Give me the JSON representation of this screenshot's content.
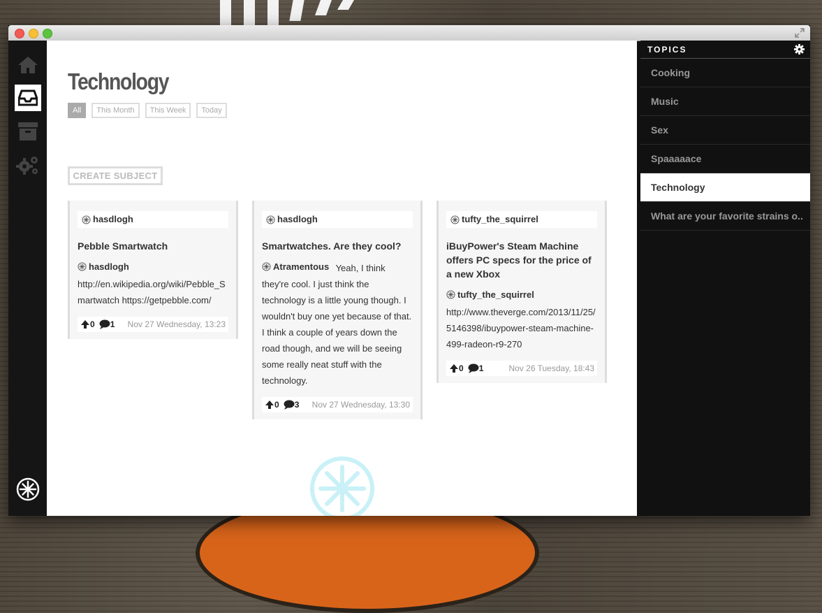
{
  "page": {
    "title": "Technology",
    "filters": [
      {
        "label": "All",
        "active": true
      },
      {
        "label": "This Month",
        "active": false
      },
      {
        "label": "This Week",
        "active": false
      },
      {
        "label": "Today",
        "active": false
      }
    ],
    "create_button": "CREATE SUBJECT"
  },
  "left_nav": {
    "items": [
      {
        "icon": "home-icon"
      },
      {
        "icon": "inbox-icon",
        "active": true
      },
      {
        "icon": "archive-icon"
      },
      {
        "icon": "gears-icon"
      }
    ],
    "footer_icon": "app-logo-icon"
  },
  "cards": [
    {
      "author": "hasdlogh",
      "subject": "Pebble Smartwatch",
      "post_author": "hasdlogh",
      "body": "http://en.wikipedia.org/wiki/Pebble_Smartwatch https://getpebble.com/",
      "upvotes": "0",
      "comments": "1",
      "date": "Nov 27 Wednesday, 13:23"
    },
    {
      "author": "hasdlogh",
      "subject": "Smartwatches. Are they cool?",
      "post_author": "Atramentous",
      "body": "Yeah, I think they're cool. I just think the technology is a little young though. I wouldn't buy one yet because of that. I think a couple of years down the road though, and we will be seeing some really neat stuff with the technology.",
      "upvotes": "0",
      "comments": "3",
      "date": "Nov 27 Wednesday, 13:30"
    },
    {
      "author": "tufty_the_squirrel",
      "subject": "iBuyPower's Steam Machine offers PC specs for the price of a new Xbox",
      "post_author": "tufty_the_squirrel",
      "body": "http://www.theverge.com/2013/11/25/5146398/ibuypower-steam-machine-499-radeon-r9-270",
      "upvotes": "0",
      "comments": "1",
      "date": "Nov 26 Tuesday, 18:43"
    }
  ],
  "topics": {
    "header": "TOPICS",
    "items": [
      {
        "label": "Cooking",
        "active": false
      },
      {
        "label": "Music",
        "active": false
      },
      {
        "label": "Sex",
        "active": false
      },
      {
        "label": "Spaaaaace",
        "active": false
      },
      {
        "label": "Technology",
        "active": true
      },
      {
        "label": "What are your favorite strains o..",
        "active": false
      }
    ]
  },
  "colors": {
    "accent_cyan": "#c9f1f7",
    "sidebar_bg": "#111111",
    "active_filter": "#aaaaaa"
  }
}
